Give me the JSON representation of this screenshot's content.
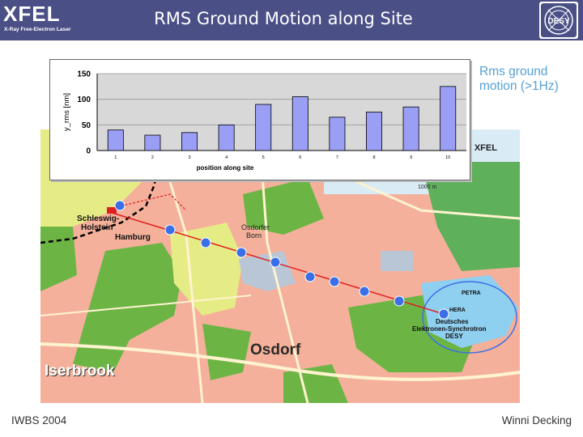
{
  "header": {
    "logo_main": "XFEL",
    "logo_sub": "X-Ray Free-Electron Laser",
    "title": "RMS Ground Motion along Site",
    "desy_logo_text": "DESY"
  },
  "legend_note": {
    "line1": "Rms ground",
    "line2": "motion (>1Hz)"
  },
  "map": {
    "labels": {
      "project": "ct XFEL",
      "scale": "1000 m",
      "schleswig_line1": "Schleswig-",
      "schleswig_line2": "Holstein",
      "hamburg": "Hamburg",
      "osdorfer_line1": "Osdorfer",
      "osdorfer_line2": "Born",
      "petra": "PETRA",
      "hera": "HERA",
      "desy_line1": "Deutsches",
      "desy_line2": "Elektronen-Synchrotron",
      "desy_line3": "DESY",
      "osdorf": "Osdorf",
      "iserbrook": "Iserbrook"
    },
    "colors": {
      "line": "#e02020",
      "marker": "#3a6fe8",
      "water": "#8fd0f0",
      "green": "#58a83c",
      "urban": "#f4b09a"
    }
  },
  "chart_data": {
    "type": "bar",
    "categories": [
      "1",
      "2",
      "3",
      "4",
      "5",
      "6",
      "7",
      "8",
      "9",
      "10"
    ],
    "values": [
      40,
      30,
      35,
      50,
      90,
      105,
      65,
      75,
      85,
      125
    ],
    "xlabel": "position along site",
    "ylabel": "y_rms [nm]",
    "ylim": [
      0,
      150
    ],
    "yticks": [
      0,
      50,
      100,
      150
    ],
    "grid": true,
    "bar_color": "#9a9ef5",
    "plot_bg": "#d8d8d8"
  },
  "footer": {
    "left": "IWBS 2004",
    "right": "Winni Decking"
  }
}
